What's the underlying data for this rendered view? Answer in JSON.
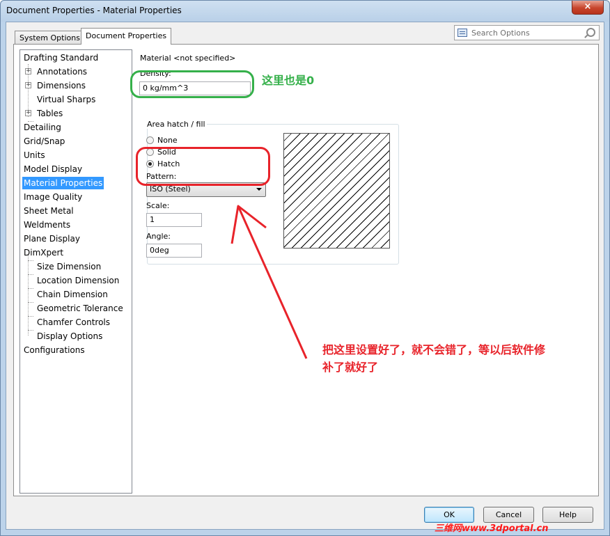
{
  "window": {
    "title": "Document Properties - Material Properties",
    "close_label": "×"
  },
  "tabs": [
    {
      "label": "System Options"
    },
    {
      "label": "Document Properties"
    }
  ],
  "search": {
    "placeholder": "Search Options"
  },
  "tree": {
    "items": [
      {
        "label": "Drafting Standard"
      },
      {
        "label": "Annotations"
      },
      {
        "label": "Dimensions"
      },
      {
        "label": "Virtual Sharps"
      },
      {
        "label": "Tables"
      },
      {
        "label": "Detailing"
      },
      {
        "label": "Grid/Snap"
      },
      {
        "label": "Units"
      },
      {
        "label": "Model Display"
      },
      {
        "label": "Material Properties"
      },
      {
        "label": "Image Quality"
      },
      {
        "label": "Sheet Metal"
      },
      {
        "label": "Weldments"
      },
      {
        "label": "Plane Display"
      },
      {
        "label": "DimXpert"
      },
      {
        "label": "Size Dimension"
      },
      {
        "label": "Location Dimension"
      },
      {
        "label": "Chain Dimension"
      },
      {
        "label": "Geometric Tolerance"
      },
      {
        "label": "Chamfer Controls"
      },
      {
        "label": "Display Options"
      },
      {
        "label": "Configurations"
      }
    ],
    "expander_symbol": "+"
  },
  "material": {
    "material_label": "Material <not specified>",
    "density_label": "Density:",
    "density_value": "0 kg/mm^3",
    "group_label": "Area hatch / fill",
    "options": [
      {
        "label": "None"
      },
      {
        "label": "Solid"
      },
      {
        "label": "Hatch"
      }
    ],
    "pattern_label": "Pattern:",
    "pattern_value": "ISO (Steel)",
    "scale_label": "Scale:",
    "scale_value": "1",
    "angle_label": "Angle:",
    "angle_value": "0deg"
  },
  "buttons": {
    "ok": "OK",
    "cancel": "Cancel",
    "help": "Help"
  },
  "annotations": {
    "green_note": "这里也是0",
    "red_note": "把这里设置好了，就不会错了，等以后软件修补了就好了",
    "green_color": "#35b04a",
    "red_color": "#e8232a"
  },
  "watermark": "三维网www.3dportal.cn"
}
